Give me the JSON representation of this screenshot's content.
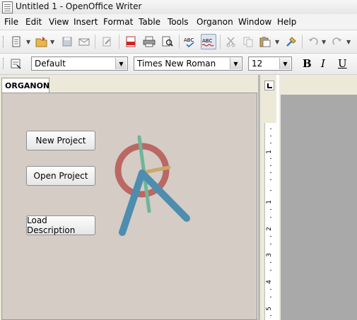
{
  "window": {
    "title": "Untitled 1 - OpenOffice Writer"
  },
  "menu": [
    "File",
    "Edit",
    "View",
    "Insert",
    "Format",
    "Table",
    "Tools",
    "Organon",
    "Window",
    "Help"
  ],
  "toolbar": {
    "paragraph_style": "Default",
    "font_name": "Times New Roman",
    "font_size": "12",
    "bold_label": "B",
    "italic_label": "I",
    "underline_label": "U"
  },
  "panel": {
    "tab_label": "ORGANON",
    "buttons": {
      "new_project": "New Project",
      "open_project": "Open Project",
      "load_description": "Load Description"
    }
  },
  "ruler": {
    "labels": [
      "1",
      "1",
      "2",
      "3",
      "4",
      "5"
    ]
  },
  "colors": {
    "logo_ring": "#b85c58",
    "logo_arms": "#4d8db0",
    "logo_green": "#6fb59a",
    "logo_tan": "#c9a86a",
    "panel_bg": "#d4ccc5"
  }
}
